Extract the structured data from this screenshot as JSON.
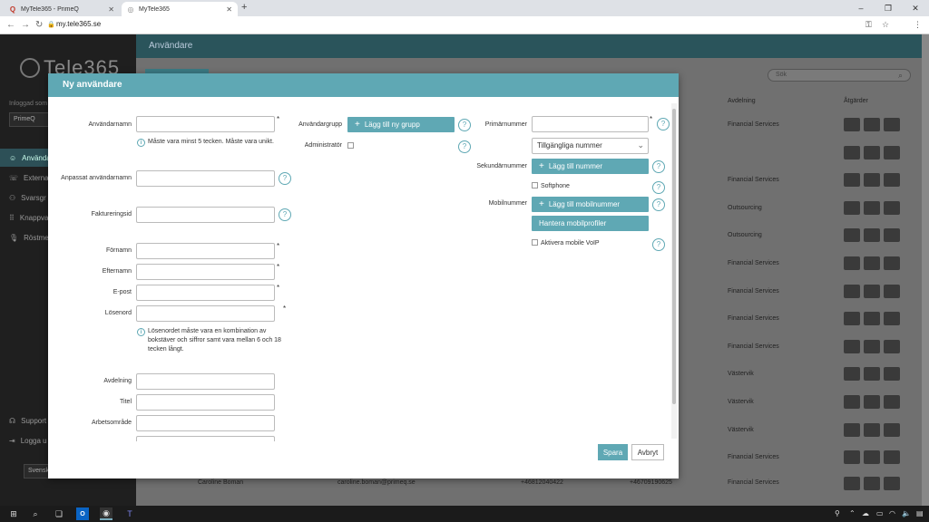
{
  "browser": {
    "tabs": [
      {
        "label": "MyTele365 - PrimeQ",
        "icon": "primeq-icon"
      },
      {
        "label": "MyTele365",
        "icon": "tele365-icon"
      }
    ],
    "url": "my.tele365.se"
  },
  "app": {
    "logo": "Tele365",
    "logged_in_label": "Inloggad som",
    "org_select": "PrimeQ",
    "nav": [
      {
        "label": "Användare"
      },
      {
        "label": "Externa"
      },
      {
        "label": "Svarsgr"
      },
      {
        "label": "Knappva"
      },
      {
        "label": "Röstme"
      }
    ],
    "support": "Support",
    "logout": "Logga u",
    "language": "Svensk",
    "page_title": "Användare",
    "search_placeholder": "Sök",
    "columns": {
      "department": "Avdelning",
      "actions": "Åtgärder"
    },
    "rows": [
      {
        "department": "Financial Services"
      },
      {
        "department": ""
      },
      {
        "department": "Financial Services"
      },
      {
        "department": "Outsourcing"
      },
      {
        "department": "Outsourcing"
      },
      {
        "department": "Financial Services"
      },
      {
        "department": "Financial Services"
      },
      {
        "department": "Financial Services"
      },
      {
        "department": "Financial Services"
      },
      {
        "department": "Västervik"
      },
      {
        "department": "Västervik"
      },
      {
        "department": "Västervik"
      },
      {
        "department": "Financial Services"
      }
    ],
    "last_row": {
      "name": "Caroline Boman",
      "email": "caroline.boman@primeq.se",
      "phone1": "+46812040422",
      "phone2": "+46709190625",
      "department": "Financial Services"
    }
  },
  "modal": {
    "title": "Ny användare",
    "left": {
      "username_label": "Användarnamn",
      "username_note": "Måste vara minst 5 tecken. Måste vara unikt.",
      "custom_username_label": "Anpassat användarnamn",
      "billing_id_label": "Faktureringsid",
      "firstname_label": "Förnamn",
      "lastname_label": "Efternamn",
      "email_label": "E-post",
      "password_label": "Lösenord",
      "password_note": "Lösenordet måste vara en kombination av bokstäver och siffror samt vara mellan 6 och 18 tecken långt.",
      "department_label": "Avdelning",
      "title_label": "Titel",
      "workarea_label": "Arbetsområde"
    },
    "middle": {
      "usergroup_label": "Användargrupp",
      "add_group_button": "Lägg till ny grupp",
      "admin_label": "Administratör"
    },
    "right": {
      "primary_label": "Primärnummer",
      "available_numbers": "Tillgängliga nummer",
      "secondary_label": "Sekundärnummer",
      "add_number_button": "Lägg till nummer",
      "softphone_label": "Softphone",
      "mobile_label": "Mobilnummer",
      "add_mobile_button": "Lägg till mobilnummer",
      "mobile_profiles_button": "Hantera mobilprofiler",
      "mobile_voip_label": "Aktivera mobile VoIP"
    },
    "required_mark": "*",
    "help_glyph": "?",
    "info_glyph": "i",
    "save_button": "Spara",
    "cancel_button": "Avbryt"
  }
}
